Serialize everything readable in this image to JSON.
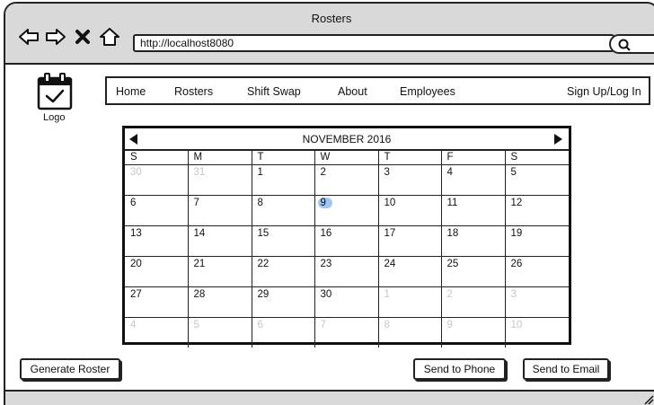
{
  "window": {
    "title": "Rosters",
    "url": "http://localhost8080"
  },
  "icons": {
    "back": "arrow-left-icon",
    "forward": "arrow-right-icon",
    "close": "close-x-icon",
    "home": "home-icon",
    "search": "search-icon",
    "logo": "calendar-check-icon"
  },
  "logo": {
    "label": "Logo"
  },
  "menu": {
    "home": "Home",
    "rosters": "Rosters",
    "shift_swap": "Shift Swap",
    "about": "About",
    "employees": "Employees",
    "signup": "Sign Up/Log In"
  },
  "calendar": {
    "month_title": "NOVEMBER 2016",
    "weekdays": [
      "S",
      "M",
      "T",
      "W",
      "T",
      "F",
      "S"
    ],
    "selected_day": "9",
    "selected_color": "#9ec7f5",
    "weeks": [
      [
        {
          "d": "30",
          "dim": true
        },
        {
          "d": "31",
          "dim": true
        },
        {
          "d": "1"
        },
        {
          "d": "2"
        },
        {
          "d": "3"
        },
        {
          "d": "4"
        },
        {
          "d": "5"
        }
      ],
      [
        {
          "d": "6"
        },
        {
          "d": "7"
        },
        {
          "d": "8"
        },
        {
          "d": "9",
          "selected": true
        },
        {
          "d": "10"
        },
        {
          "d": "11"
        },
        {
          "d": "12"
        }
      ],
      [
        {
          "d": "13"
        },
        {
          "d": "14"
        },
        {
          "d": "15"
        },
        {
          "d": "16"
        },
        {
          "d": "17"
        },
        {
          "d": "18"
        },
        {
          "d": "19"
        }
      ],
      [
        {
          "d": "20"
        },
        {
          "d": "21"
        },
        {
          "d": "22"
        },
        {
          "d": "23"
        },
        {
          "d": "24"
        },
        {
          "d": "25"
        },
        {
          "d": "26"
        }
      ],
      [
        {
          "d": "27"
        },
        {
          "d": "28"
        },
        {
          "d": "29"
        },
        {
          "d": "30"
        },
        {
          "d": "1",
          "dim": true
        },
        {
          "d": "2",
          "dim": true
        },
        {
          "d": "3",
          "dim": true
        }
      ],
      [
        {
          "d": "4",
          "dim": true
        },
        {
          "d": "5",
          "dim": true
        },
        {
          "d": "6",
          "dim": true
        },
        {
          "d": "7",
          "dim": true
        },
        {
          "d": "8",
          "dim": true
        },
        {
          "d": "9",
          "dim": true
        },
        {
          "d": "10",
          "dim": true
        }
      ]
    ]
  },
  "buttons": {
    "generate": "Generate Roster",
    "send_phone": "Send to Phone",
    "send_email": "Send to Email"
  }
}
